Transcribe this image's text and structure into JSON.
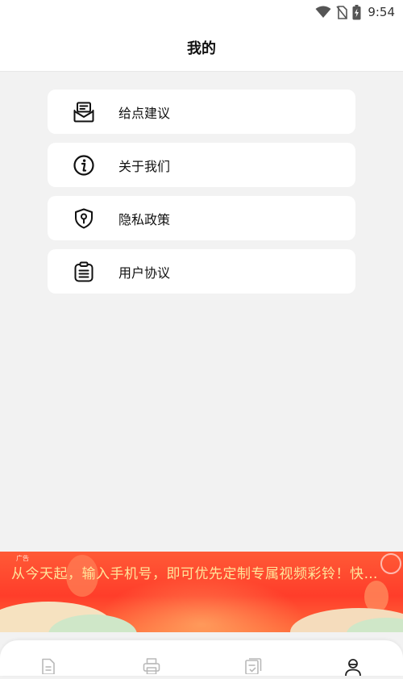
{
  "status_bar": {
    "time": "9:54",
    "icons": [
      "wifi-icon",
      "no-sim-icon",
      "battery-charging-icon"
    ]
  },
  "header": {
    "title": "我的"
  },
  "menu": {
    "items": [
      {
        "label": "给点建议",
        "icon": "mail-icon"
      },
      {
        "label": "关于我们",
        "icon": "info-icon"
      },
      {
        "label": "隐私政策",
        "icon": "shield-lock-icon"
      },
      {
        "label": "用户协议",
        "icon": "clipboard-icon"
      }
    ]
  },
  "ad": {
    "tag": "广告",
    "text": "从今天起，输入手机号，即可优先定制专属视频彩铃！快速抢占"
  },
  "tab_bar": {
    "tabs": [
      {
        "icon": "document-icon",
        "active": false
      },
      {
        "icon": "printer-icon",
        "active": false
      },
      {
        "icon": "files-icon",
        "active": false
      },
      {
        "icon": "user-icon",
        "active": true
      }
    ]
  },
  "colors": {
    "background": "#f2f2f2",
    "card": "#ffffff",
    "ad_red": "#ff3d2a",
    "ad_text": "#ffe49a",
    "tab_inactive": "#b9b9b9",
    "tab_active": "#222222"
  }
}
